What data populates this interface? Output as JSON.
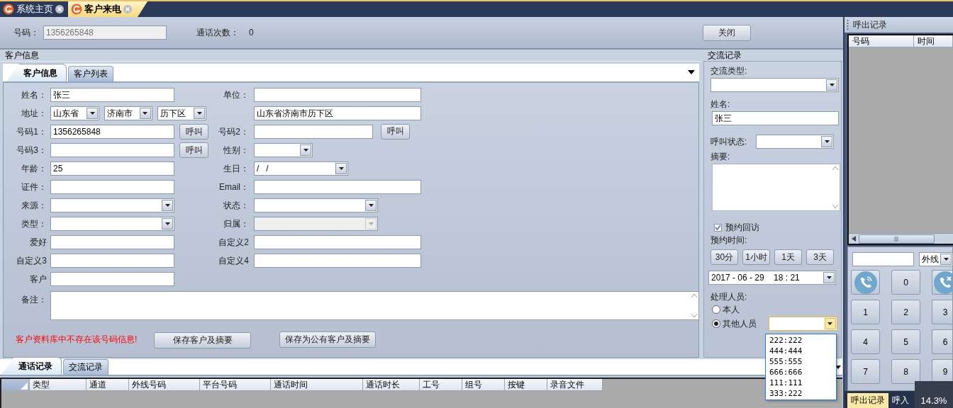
{
  "app_tabs": [
    {
      "label": "系统主页",
      "selected": false
    },
    {
      "label": "客户来电",
      "selected": true
    }
  ],
  "header": {
    "number_label": "号码：",
    "number_value": "1356265848",
    "number_disabled": true,
    "count_label": "通话次数：",
    "count_value": "0",
    "close_button": "关闭"
  },
  "customer": {
    "title": "客户信息",
    "tabs": [
      {
        "label": "客户信息",
        "selected": true
      },
      {
        "label": "客户列表",
        "selected": false
      }
    ],
    "rows": [
      {
        "left": {
          "kind": "text",
          "label": "姓名：",
          "value": "张三",
          "disabled": false
        },
        "right": {
          "kind": "text",
          "label": "单位：",
          "disabled": false
        }
      },
      {
        "left": {
          "kind": "address",
          "label": "地址：",
          "values": [
            "山东省",
            "济南市",
            "历下区"
          ],
          "disabled": false
        },
        "right": {
          "kind": "text",
          "value": "山东省济南市历下区",
          "disabled": false
        }
      },
      {
        "left": {
          "kind": "text",
          "label": "号码1：",
          "value": "1356265848",
          "call_button": "呼叫",
          "disabled": false
        },
        "right": {
          "kind": "text",
          "label": "号码2：",
          "call_button": "呼叫",
          "disabled": false
        }
      },
      {
        "left": {
          "kind": "text",
          "label": "号码3：",
          "call_button": "呼叫",
          "disabled": false
        },
        "right": {
          "kind": "combo",
          "label": "性别：",
          "disabled": false
        }
      },
      {
        "left": {
          "kind": "text",
          "label": "年龄：",
          "value": "25",
          "disabled": false
        },
        "right": {
          "kind": "combo",
          "label": "生日：",
          "value": "/   /",
          "disabled": false
        }
      },
      {
        "left": {
          "kind": "text",
          "label": "证件：",
          "disabled": false
        },
        "right": {
          "kind": "text",
          "label": "Email：",
          "disabled": false
        }
      },
      {
        "left": {
          "kind": "combo",
          "label": "来源：",
          "disabled": false
        },
        "right": {
          "kind": "combo",
          "label": "状态：",
          "disabled": false
        }
      },
      {
        "left": {
          "kind": "combo",
          "label": "类型：",
          "disabled": false
        },
        "right": {
          "kind": "combo",
          "label": "归属：",
          "disabled": true
        }
      },
      {
        "left": {
          "kind": "text",
          "label": "爱好",
          "disabled": false
        },
        "right": {
          "kind": "text",
          "label": "自定义2",
          "disabled": false
        }
      },
      {
        "left": {
          "kind": "text",
          "label": "自定义3",
          "disabled": false
        },
        "right": {
          "kind": "text",
          "label": "自定义4",
          "disabled": false
        }
      },
      {
        "left": {
          "kind": "text",
          "label": "客户",
          "disabled": false
        }
      }
    ],
    "note_label": "备注：",
    "message": "客户资料库中不存在该号码信息!",
    "buttons": [
      "保存客户及摘要",
      "保存为公有客户及摘要"
    ]
  },
  "exchange": {
    "title": "交流记录",
    "type_label": "交流类型:",
    "name_label": "姓名:",
    "name_value": "张三",
    "status_label": "呼叫状态:",
    "summary_label": "摘要:",
    "revisit": {
      "label": "预约回访",
      "checked": true
    },
    "time_label": "预约时间:",
    "quick_buttons": [
      "30分",
      "1小时",
      "1天",
      "3天"
    ],
    "datetime": "2017 - 06 - 29    18 : 21",
    "handler_label": "处理人员:",
    "handlers": [
      {
        "label": "本人",
        "selected": false
      },
      {
        "label": "其他人员",
        "selected": true
      }
    ],
    "handler_dropdown": {
      "expanded": true,
      "options": [
        {
          "label": "222:222",
          "selected": false
        },
        {
          "label": "444:444",
          "selected": false
        },
        {
          "label": "555:555",
          "selected": false
        },
        {
          "label": "666:666",
          "selected": false
        },
        {
          "label": "111:111",
          "selected": false
        },
        {
          "label": "333:222",
          "selected": false
        }
      ]
    }
  },
  "calls": {
    "tabs": [
      {
        "label": "通话记录",
        "selected": true
      },
      {
        "label": "交流记录",
        "selected": false
      }
    ],
    "columns": [
      "类型",
      "通道",
      "外线号码",
      "平台号码",
      "通话时间",
      "通话时长",
      "工号",
      "组号",
      "按键",
      "录音文件"
    ]
  },
  "outbound": {
    "title": "呼出记录",
    "columns": [
      "号码",
      "时间"
    ],
    "line_combo": "外线",
    "keys": [
      {
        "kind": "call"
      },
      {
        "kind": "digit",
        "label": "0"
      },
      {
        "kind": "hangup"
      },
      {
        "kind": "digit",
        "label": "1"
      },
      {
        "kind": "digit",
        "label": "2"
      },
      {
        "kind": "digit",
        "label": "3"
      },
      {
        "kind": "digit",
        "label": "4"
      },
      {
        "kind": "digit",
        "label": "5"
      },
      {
        "kind": "digit",
        "label": "6"
      },
      {
        "kind": "digit",
        "label": "7"
      },
      {
        "kind": "digit",
        "label": "8"
      },
      {
        "kind": "digit",
        "label": "9"
      }
    ],
    "tabs": [
      {
        "label": "呼出记录",
        "selected": true
      },
      {
        "label": "呼入",
        "selected": false
      }
    ]
  },
  "badge": "14.3%"
}
